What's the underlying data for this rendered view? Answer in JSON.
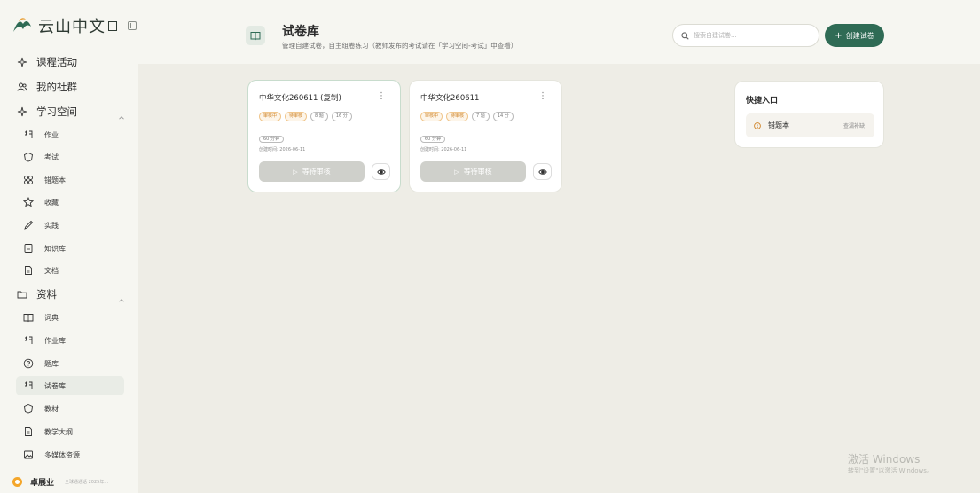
{
  "brand": {
    "name": "云山中文",
    "logo_icon": "mountain-logo-icon",
    "toggle_icon": "sidebar-collapse-icon"
  },
  "sidebar": {
    "items": [
      {
        "label": "课程活动",
        "icon": "sparkle-icon",
        "level": "top"
      },
      {
        "label": "我的社群",
        "icon": "users-icon",
        "level": "top"
      },
      {
        "label": "学习空间",
        "icon": "sparkle-icon",
        "level": "top",
        "expanded": true
      },
      {
        "label": "作业",
        "icon": "homework-icon",
        "level": "sub"
      },
      {
        "label": "考试",
        "icon": "exam-icon",
        "level": "sub"
      },
      {
        "label": "错题本",
        "icon": "grid-icon",
        "level": "sub"
      },
      {
        "label": "收藏",
        "icon": "star-icon",
        "level": "sub"
      },
      {
        "label": "实践",
        "icon": "pen-icon",
        "level": "sub"
      },
      {
        "label": "知识库",
        "icon": "book-icon",
        "level": "sub"
      },
      {
        "label": "文档",
        "icon": "document-icon",
        "level": "sub"
      },
      {
        "label": "资料",
        "icon": "folder-icon",
        "level": "top",
        "expanded": true
      },
      {
        "label": "词典",
        "icon": "open-book-icon",
        "level": "sub"
      },
      {
        "label": "作业库",
        "icon": "homework-icon",
        "level": "sub"
      },
      {
        "label": "题库",
        "icon": "question-icon",
        "level": "sub"
      },
      {
        "label": "试卷库",
        "icon": "homework-icon",
        "level": "sub",
        "active": true
      },
      {
        "label": "教材",
        "icon": "exam-icon",
        "level": "sub"
      },
      {
        "label": "教学大纲",
        "icon": "document-icon",
        "level": "sub"
      },
      {
        "label": "多媒体资源",
        "icon": "image-icon",
        "level": "sub"
      }
    ]
  },
  "user": {
    "name": "卓展业",
    "note": "全球通通话 2025年..."
  },
  "header": {
    "title": "试卷库",
    "subtitle": "管理自建试卷，自主组卷练习（教师发布的考试请在「学习空间-考试」中查看）",
    "search_placeholder": "搜索自建试卷...",
    "create_label": "创建试卷"
  },
  "cards": [
    {
      "title": "中华文化260611 (复制)",
      "tags": [
        "审核中",
        "待审核",
        "8 题",
        "16 分"
      ],
      "duration": "60 分钟",
      "date": "创建时间: 2026-06-11",
      "action": "等待审核"
    },
    {
      "title": "中华文化260611",
      "tags": [
        "审核中",
        "待审核",
        "7 题",
        "14 分"
      ],
      "duration": "60 分钟",
      "date": "创建时间: 2026-06-11",
      "action": "等待审核"
    }
  ],
  "quick": {
    "title": "快捷入口",
    "item_label": "错题本",
    "item_link": "查漏补缺"
  },
  "watermark": {
    "line1": "激活 Windows",
    "line2": "转到\"设置\"以激活 Windows。"
  },
  "colors": {
    "accent": "#2f6b55",
    "pending": "#d0852a",
    "active_bg": "#e9ece6"
  }
}
